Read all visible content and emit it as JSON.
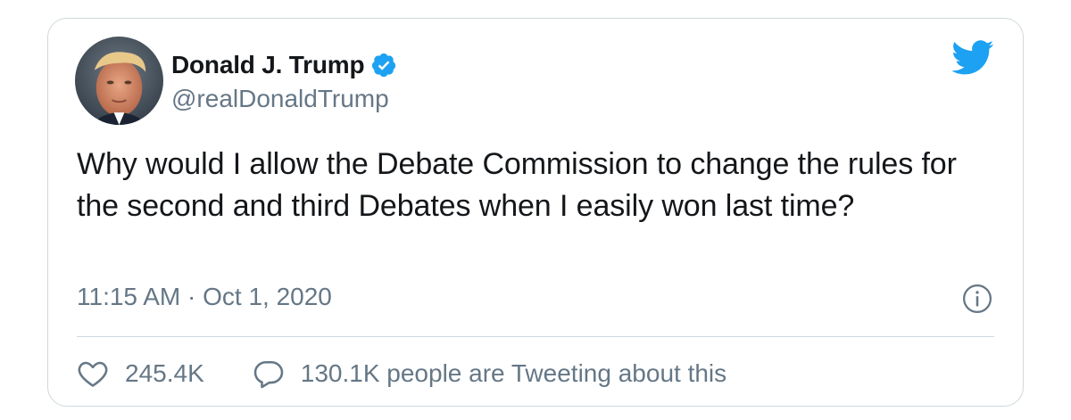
{
  "tweet": {
    "author": {
      "display_name": "Donald J. Trump",
      "handle": "@realDonaldTrump",
      "verified": true
    },
    "text": "Why would I allow the Debate Commission to change the rules for the second and third Debates when I easily won last time?",
    "timestamp": "11:15 AM · Oct 1, 2020",
    "likes": "245.4K",
    "replies_label": "130.1K people are Tweeting about this"
  },
  "colors": {
    "brand_blue": "#1da1f2",
    "text_primary": "#14171a",
    "text_secondary": "#657786",
    "border": "#cfd9de"
  },
  "icons": [
    "avatar",
    "verified-badge-icon",
    "twitter-bird-icon",
    "info-icon",
    "heart-icon",
    "reply-icon"
  ]
}
